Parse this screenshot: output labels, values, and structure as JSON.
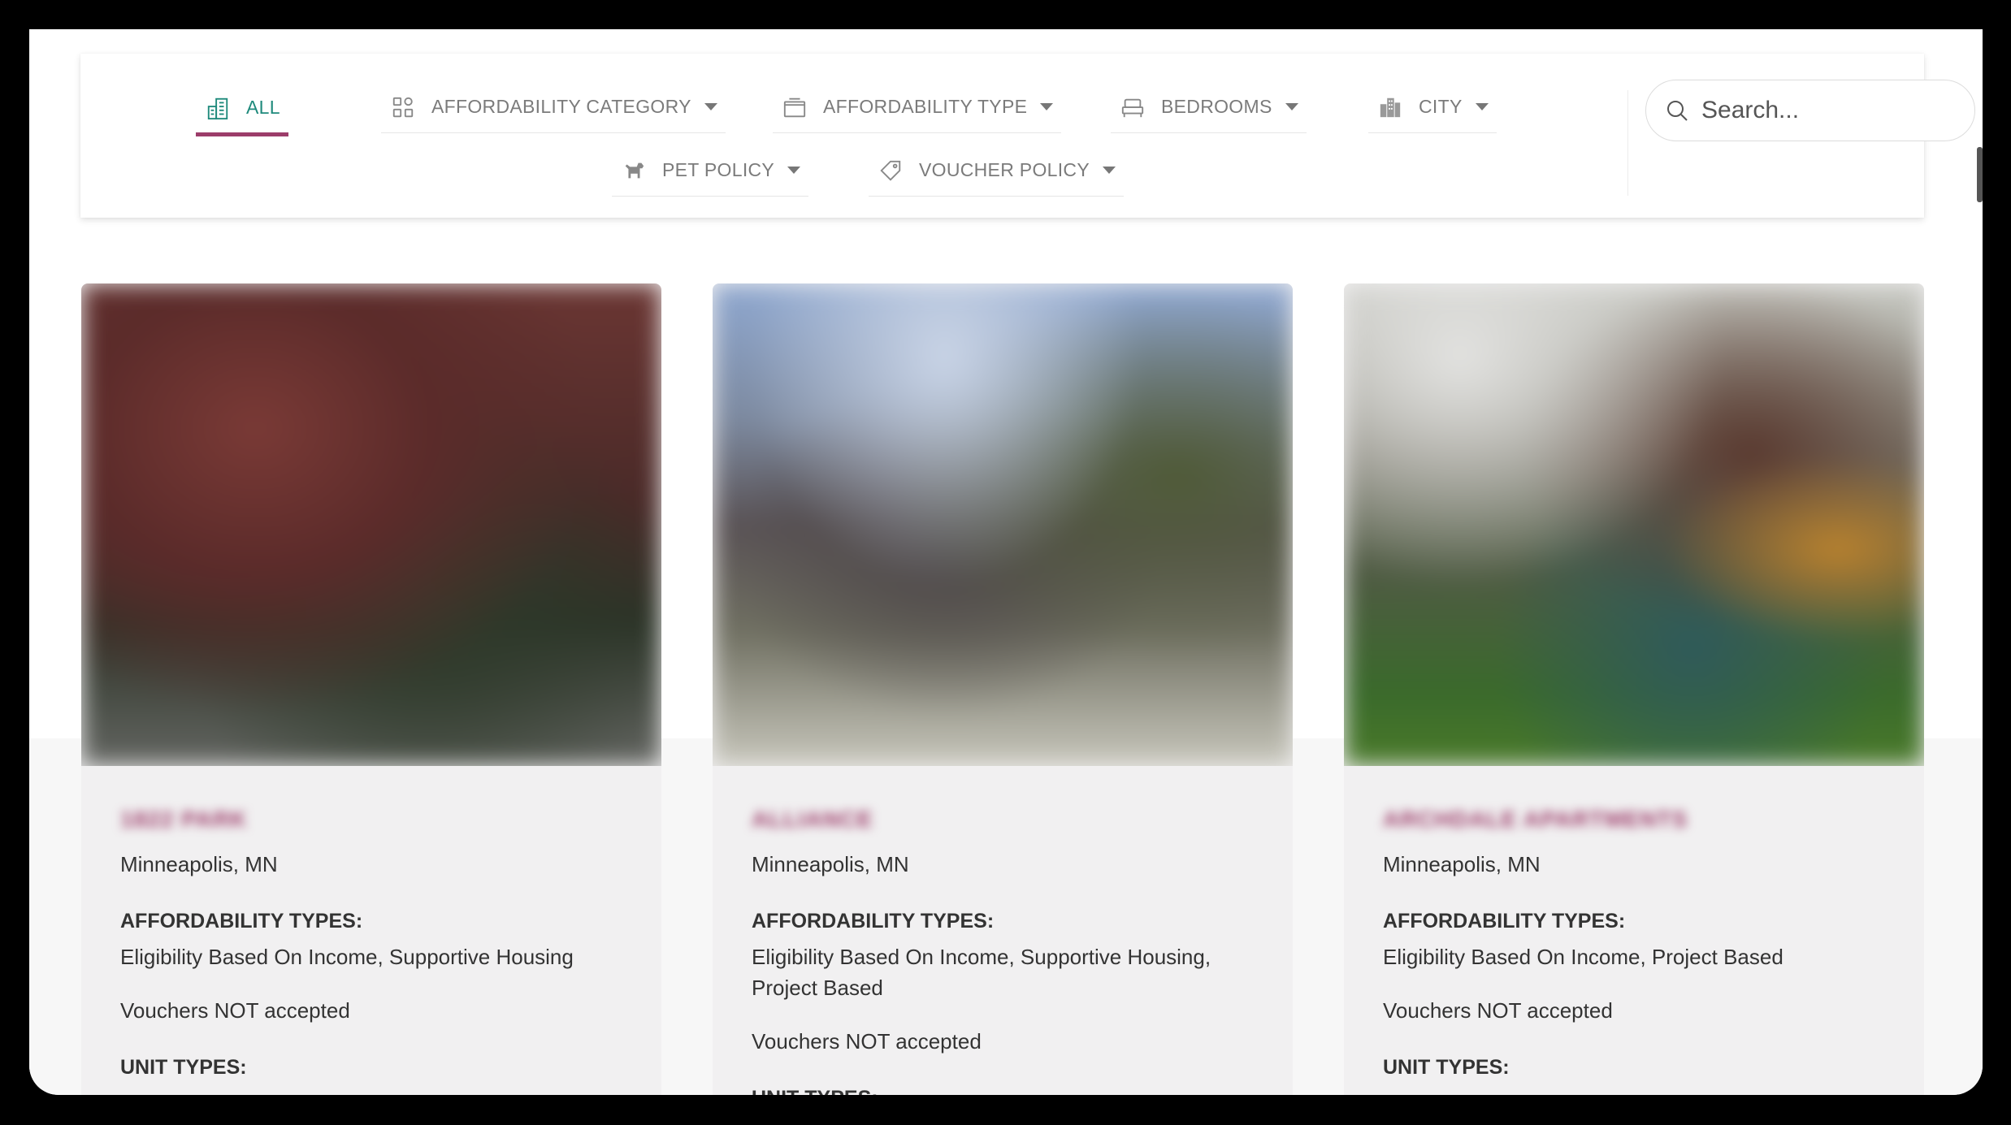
{
  "filters": {
    "all": {
      "label": "ALL",
      "icon": "building-icon"
    },
    "affordability_category": {
      "label": "AFFORDABILITY CATEGORY",
      "icon": "grid-icon"
    },
    "affordability_type": {
      "label": "AFFORDABILITY TYPE",
      "icon": "box-icon"
    },
    "bedrooms": {
      "label": "BEDROOMS",
      "icon": "bed-icon"
    },
    "city": {
      "label": "CITY",
      "icon": "city-icon"
    },
    "pet_policy": {
      "label": "PET POLICY",
      "icon": "dog-icon"
    },
    "voucher_policy": {
      "label": "VOUCHER POLICY",
      "icon": "ticket-icon"
    }
  },
  "search": {
    "placeholder": "Search...",
    "value": ""
  },
  "colors": {
    "accent": "#9c3d6a",
    "active_text": "#1f8a7c",
    "card_bg": "#f1f0f1"
  },
  "cards": [
    {
      "title": "1822 PARK",
      "city": "Minneapolis, MN",
      "affordability_label": "AFFORDABILITY TYPES:",
      "affordability_types": "Eligibility Based On Income, Supportive Housing",
      "vouchers": "Vouchers NOT accepted",
      "unit_types_label": "UNIT TYPES:"
    },
    {
      "title": "ALLIANCE",
      "city": "Minneapolis, MN",
      "affordability_label": "AFFORDABILITY TYPES:",
      "affordability_types": "Eligibility Based On Income, Supportive Housing, Project Based",
      "vouchers": "Vouchers NOT accepted",
      "unit_types_label": "UNIT TYPES:"
    },
    {
      "title": "ARCHDALE APARTMENTS",
      "city": "Minneapolis, MN",
      "affordability_label": "AFFORDABILITY TYPES:",
      "affordability_types": "Eligibility Based On Income, Project Based",
      "vouchers": "Vouchers NOT accepted",
      "unit_types_label": "UNIT TYPES:"
    }
  ]
}
